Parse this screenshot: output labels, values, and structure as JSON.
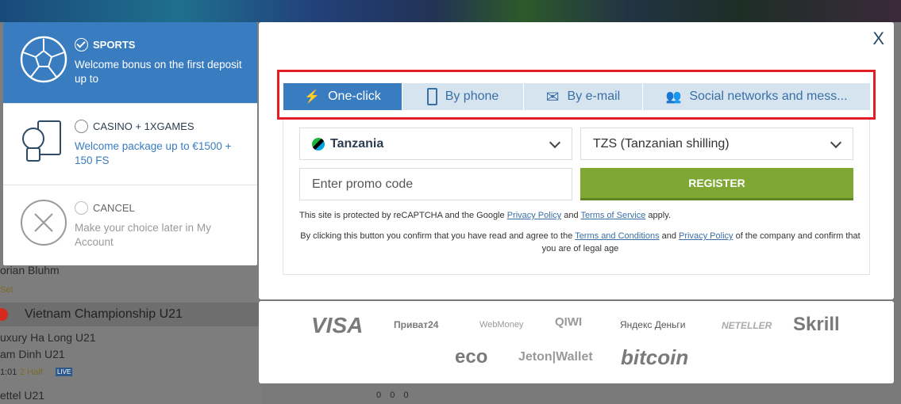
{
  "background": {
    "rows": [
      "orian Bluhm",
      "Set",
      "Vietnam Championship U21",
      "uxury Ha Long U21",
      "am Dinh U21",
      "1:01",
      "2 Half",
      "LIVE",
      "ettel U21"
    ],
    "scores": [
      "0",
      "0",
      "0"
    ]
  },
  "bonus": {
    "options": [
      {
        "title": "SPORTS",
        "desc": "Welcome bonus on the first deposit up to",
        "selected": true,
        "icon": "soccer-ball-icon"
      },
      {
        "title": "CASINO + 1XGAMES",
        "desc": "Welcome package up to €1500 + 150 FS",
        "selected": false,
        "icon": "casino-cards-icon"
      },
      {
        "title": "CANCEL",
        "desc": "Make your choice later in My Account",
        "selected": false,
        "icon": "cancel-x-icon"
      }
    ]
  },
  "modal": {
    "close": "X",
    "tabs": [
      {
        "label": "One-click",
        "icon": "lightning-icon",
        "active": true
      },
      {
        "label": "By phone",
        "icon": "phone-icon"
      },
      {
        "label": "By e-mail",
        "icon": "envelope-icon"
      },
      {
        "label": "Social networks and mess...",
        "icon": "users-icon"
      }
    ],
    "country": "Tanzania",
    "currency": "TZS (Tanzanian shilling)",
    "promo_placeholder": "Enter promo code",
    "register": "REGISTER",
    "recaptcha": {
      "pre": "This site is protected by reCAPTCHA and the Google ",
      "privacy": "Privacy Policy",
      "mid": " and ",
      "terms": "Terms of Service",
      "post": " apply."
    },
    "consent": {
      "pre": "By clicking this button you confirm that you have read and agree to the ",
      "terms": "Terms and Conditions",
      "mid": " and ",
      "privacy": "Privacy Policy",
      "post": " of the company and confirm that you are of legal age"
    }
  },
  "payments": [
    "VISA",
    "Приват24",
    "WebMoney",
    "QIWI",
    "Яндекс Деньги",
    "NETELLER",
    "Skrill",
    "eco",
    "Jeton|Wallet",
    "bitcoin"
  ],
  "colors": {
    "primary": "#3a7cc0",
    "register": "#7ea733",
    "highlight": "#e31e24"
  }
}
